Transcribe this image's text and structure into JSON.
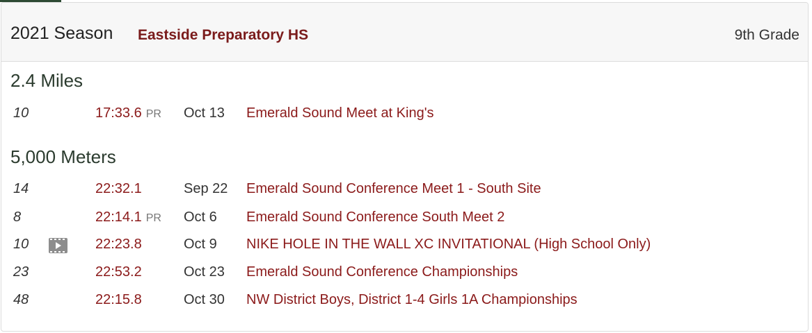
{
  "header": {
    "season": "2021 Season",
    "school": "Eastside Preparatory HS",
    "grade": "9th Grade"
  },
  "sections": [
    {
      "title": "2.4 Miles",
      "rows": [
        {
          "place": "10",
          "time": "17:33.6",
          "pr": "PR",
          "date": "Oct 13",
          "meet": "Emerald Sound Meet at King's"
        }
      ]
    },
    {
      "title": "5,000 Meters",
      "rows": [
        {
          "place": "14",
          "time": "22:32.1",
          "pr": "",
          "date": "Sep 22",
          "meet": "Emerald Sound Conference Meet 1 - South Site"
        },
        {
          "place": "8",
          "time": "22:14.1",
          "pr": "PR",
          "date": "Oct 6",
          "meet": "Emerald Sound Conference South Meet 2"
        },
        {
          "place": "10",
          "time": "22:23.8",
          "pr": "",
          "date": "Oct 9",
          "meet": "NIKE HOLE IN THE WALL XC INVITATIONAL (High School Only)",
          "icon": "video-icon"
        },
        {
          "place": "23",
          "time": "22:53.2",
          "pr": "",
          "date": "Oct 23",
          "meet": "Emerald Sound Conference Championships"
        },
        {
          "place": "48",
          "time": "22:15.8",
          "pr": "",
          "date": "Oct 30",
          "meet": "NW District Boys, District 1-4 Girls 1A Championships"
        }
      ]
    }
  ]
}
